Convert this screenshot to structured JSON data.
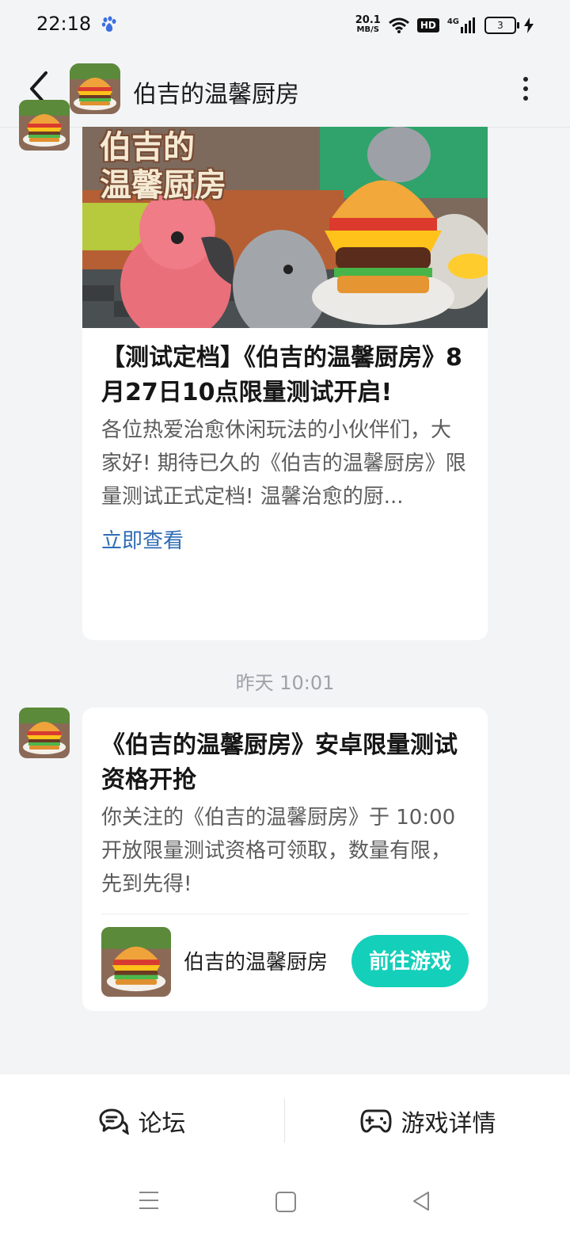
{
  "status_bar": {
    "time": "22:18",
    "net_speed_value": "20.1",
    "net_speed_unit": "MB/S",
    "hd_label": "HD",
    "signal_label": "4G",
    "battery_level": "3"
  },
  "header": {
    "title": "伯吉的温馨厨房",
    "back_icon": "chevron-left-icon",
    "more_icon": "more-vertical-icon"
  },
  "messages": [
    {
      "banner_text": "伯吉的\n温馨厨房",
      "title": "【测试定档】《伯吉的温馨厨房》8月27日10点限量测试开启!",
      "description": "各位热爱治愈休闲玩法的小伙伴们，大家好! 期待已久的《伯吉的温馨厨房》限量测试正式定档! 温馨治愈的厨...",
      "link_label": "立即查看"
    },
    {
      "timestamp": "昨天  10:01",
      "title": "《伯吉的温馨厨房》安卓限量测试资格开抢",
      "description": "你关注的《伯吉的温馨厨房》于 10:00 开放限量测试资格可领取，数量有限，先到先得!",
      "game_name": "伯吉的温馨厨房",
      "action_label": "前往游戏"
    }
  ],
  "bottom_tabs": [
    {
      "label": "论坛",
      "icon": "chat-bubbles-icon"
    },
    {
      "label": "游戏详情",
      "icon": "gamepad-icon"
    }
  ],
  "colors": {
    "accent": "#14cfb9",
    "link": "#2f6db4",
    "background": "#f3f4f6"
  }
}
